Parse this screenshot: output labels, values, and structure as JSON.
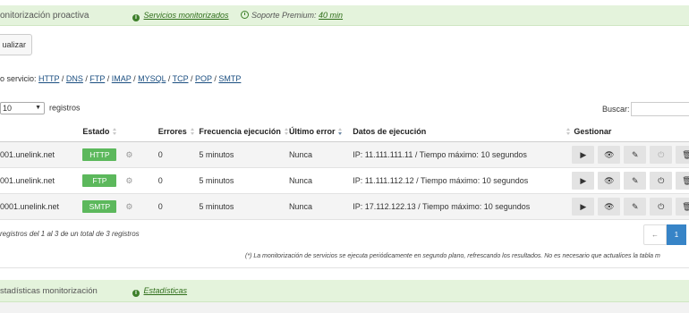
{
  "monitor_panel": {
    "title": "onitorización proactiva",
    "monitored_services_link": "Servicios monitorizados",
    "premium_support_prefix": "Soporte Premium: ",
    "premium_support_time": "40 min"
  },
  "toolbar": {
    "update_button": "ualizar"
  },
  "service_filter": {
    "label": "o servicio: ",
    "options": [
      "HTTP",
      "DNS",
      "FTP",
      "IMAP",
      "MYSQL",
      "TCP",
      "POP",
      "SMTP"
    ],
    "separator": " / "
  },
  "table_controls": {
    "page_length": "10",
    "page_length_suffix": "registros",
    "search_label": "Buscar:",
    "search_value": ""
  },
  "table": {
    "columns": {
      "estado": "Estado",
      "errores": "Errores",
      "frecuencia": "Frecuencia ejecución",
      "ultimo_error": "Último error",
      "datos": "Datos de ejecución",
      "gestionar": "Gestionar"
    },
    "rows": [
      {
        "host": "001.unelink.net",
        "estado": "HTTP",
        "errores": "0",
        "frecuencia": "5 minutos",
        "ultimo_error": "Nunca",
        "datos": "IP: 11.111.111.11 / Tiempo máximo: 10 segundos",
        "power_disabled": true
      },
      {
        "host": "001.unelink.net",
        "estado": "FTP",
        "errores": "0",
        "frecuencia": "5 minutos",
        "ultimo_error": "Nunca",
        "datos": "IP: 11.111.112.12 / Tiempo máximo: 10 segundos",
        "power_disabled": false
      },
      {
        "host": "0001.unelink.net",
        "estado": "SMTP",
        "errores": "0",
        "frecuencia": "5 minutos",
        "ultimo_error": "Nunca",
        "datos": "IP: 17.112.122.13 / Tiempo máximo: 10 segundos",
        "power_disabled": false
      }
    ]
  },
  "table_info": "registros del 1 al 3 de un total de 3 registros",
  "pagination": {
    "previous": "←",
    "current": "1"
  },
  "note": "(*) La monitorización de servicios se ejecuta periódicamente en segundo plano, refrescando los resultados. No es necesario que actualices la tabla m",
  "stats_panel": {
    "title": "stadísticas monitorización",
    "stats_link": "Estadísticas"
  },
  "colors": {
    "panel_green": "#e4f3dc",
    "badge_green": "#5cb85c",
    "pager_active": "#3784c7",
    "link_blue": "#1a4e80"
  }
}
